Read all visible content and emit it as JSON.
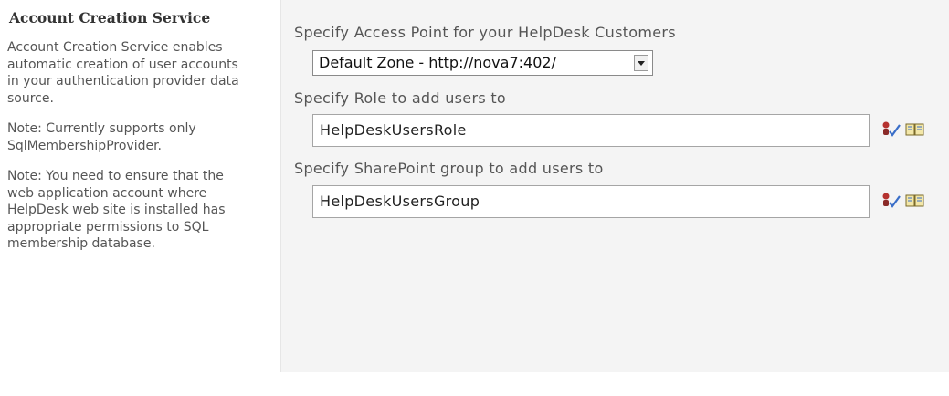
{
  "left": {
    "title": "Account Creation Service",
    "paragraphs": [
      "Account Creation Service enables automatic creation of user accounts in your authentication provider data source.",
      "Note: Currently supports only SqlMembershipProvider.",
      "Note: You need to ensure that the web application account where HelpDesk web site is installed has appropriate permissions to SQL membership database."
    ]
  },
  "form": {
    "access_point_label": "Specify Access Point for your HelpDesk Customers",
    "access_point_value": "Default Zone - http://nova7:402/",
    "role_label": "Specify Role to add users to",
    "role_value": "HelpDeskUsersRole",
    "group_label": "Specify SharePoint group to add users to",
    "group_value": "HelpDeskUsersGroup"
  },
  "icons": {
    "check_names": "check-names-icon",
    "browse": "address-book-icon"
  }
}
